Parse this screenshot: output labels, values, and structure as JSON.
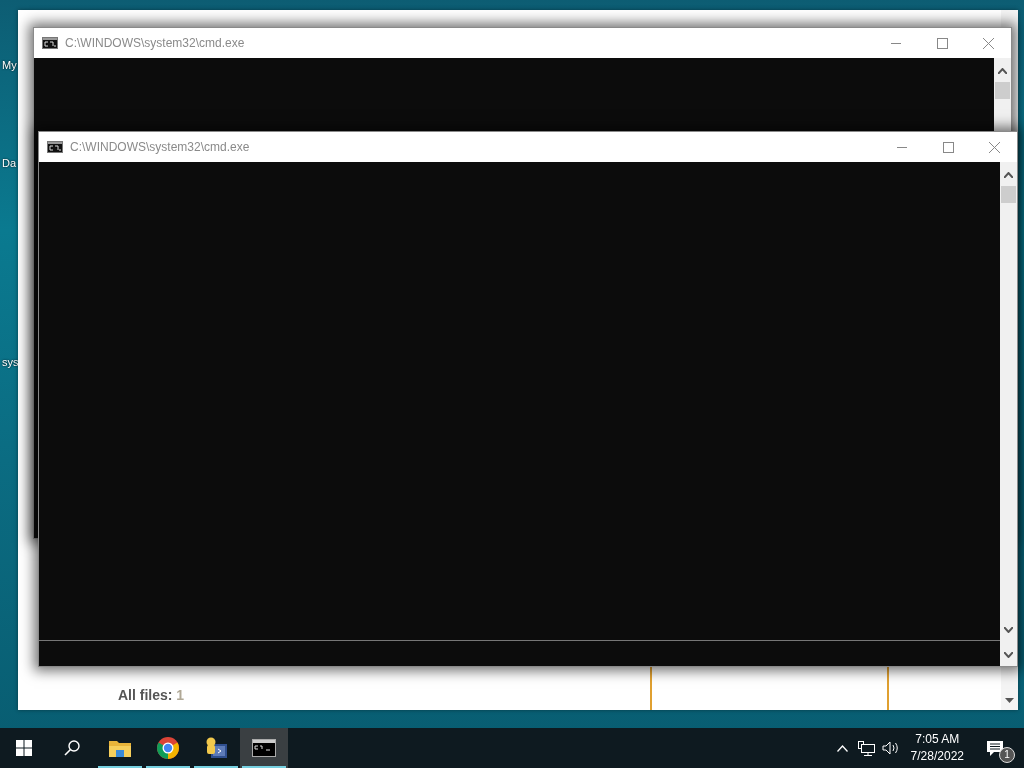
{
  "desktop": {
    "icon_labels": [
      "My",
      "Da",
      "sys"
    ]
  },
  "background_window": {
    "summary_label": "All files:",
    "summary_value": "1"
  },
  "windows": [
    {
      "title": "C:\\WINDOWS\\system32\\cmd.exe"
    },
    {
      "title": "C:\\WINDOWS\\system32\\cmd.exe"
    }
  ],
  "taskbar": {
    "apps": [
      {
        "kind": "folder",
        "running": true,
        "selected": false
      },
      {
        "kind": "browser",
        "running": true,
        "selected": false
      },
      {
        "kind": "editor",
        "running": true,
        "selected": false
      },
      {
        "kind": "terminal",
        "running": true,
        "selected": true
      }
    ],
    "clock": {
      "time": "7:05 AM",
      "date": "7/28/2022"
    },
    "notifications": {
      "count": "1"
    }
  }
}
